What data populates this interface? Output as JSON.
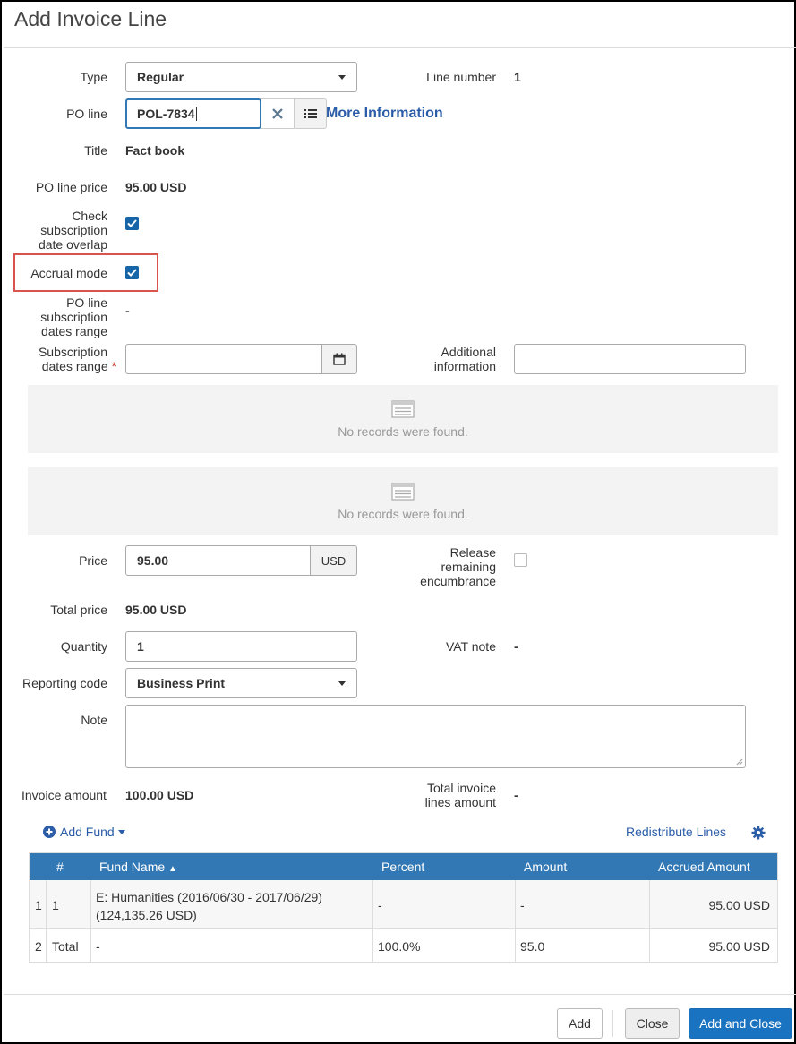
{
  "dialog": {
    "title": "Add Invoice Line"
  },
  "form": {
    "type": {
      "label": "Type",
      "value": "Regular"
    },
    "line_number": {
      "label": "Line number",
      "value": "1"
    },
    "po_line": {
      "label": "PO line",
      "value": "POL-7834",
      "more_info": "More Information"
    },
    "title": {
      "label": "Title",
      "value": "Fact book"
    },
    "po_line_price": {
      "label": "PO line price",
      "value": "95.00 USD"
    },
    "check_overlap": {
      "label_1": "Check",
      "label_2": "subscription",
      "label_3": "date overlap",
      "checked": true
    },
    "accrual_mode": {
      "label": "Accrual mode",
      "checked": true
    },
    "po_sub_range": {
      "label_1": "PO line",
      "label_2": "subscription",
      "label_3": "dates range",
      "value": "-"
    },
    "sub_dates_range": {
      "label_1": "Subscription",
      "label_2": "dates range",
      "required_mark": "*",
      "value": ""
    },
    "additional_info": {
      "label_1": "Additional",
      "label_2": "information",
      "value": ""
    },
    "empty_panels": [
      {
        "text": "No records were found."
      },
      {
        "text": "No records were found."
      }
    ],
    "price": {
      "label": "Price",
      "value": "95.00",
      "currency": "USD"
    },
    "release_encumbrance": {
      "label_1": "Release",
      "label_2": "remaining",
      "label_3": "encumbrance",
      "checked": false
    },
    "total_price": {
      "label": "Total price",
      "value": "95.00 USD"
    },
    "quantity": {
      "label": "Quantity",
      "value": "1"
    },
    "vat_note": {
      "label": "VAT note",
      "value": "-"
    },
    "reporting_code": {
      "label": "Reporting code",
      "value": "Business Print"
    },
    "note": {
      "label": "Note",
      "value": ""
    },
    "invoice_amount": {
      "label": "Invoice amount",
      "value": "100.00 USD"
    },
    "total_invoice_lines": {
      "label_1": "Total invoice",
      "label_2": "lines amount",
      "value": "-"
    }
  },
  "funds": {
    "add_fund": "Add Fund",
    "redistribute": "Redistribute Lines",
    "columns": {
      "num": "#",
      "fund_name": "Fund Name",
      "sort_arrow": "▲",
      "percent": "Percent",
      "amount": "Amount",
      "accrued": "Accrued Amount"
    },
    "rows": [
      {
        "idx": "1",
        "num": "1",
        "fund_line1": "E: Humanities (2016/06/30 - 2017/06/29)",
        "fund_line2": "(124,135.26 USD)",
        "percent": "-",
        "amount": "-",
        "accrued": "95.00 USD"
      },
      {
        "idx": "2",
        "num": "Total",
        "fund_line1": "-",
        "fund_line2": "",
        "percent": "100.0%",
        "amount": "95.0",
        "accrued": "95.00 USD"
      }
    ]
  },
  "footer": {
    "add": "Add",
    "close": "Close",
    "add_close": "Add and Close"
  },
  "colors": {
    "accent": "#3278b5",
    "primary_button": "#1a73c0",
    "highlight_border": "#d9534f",
    "link": "#2b5da8"
  }
}
